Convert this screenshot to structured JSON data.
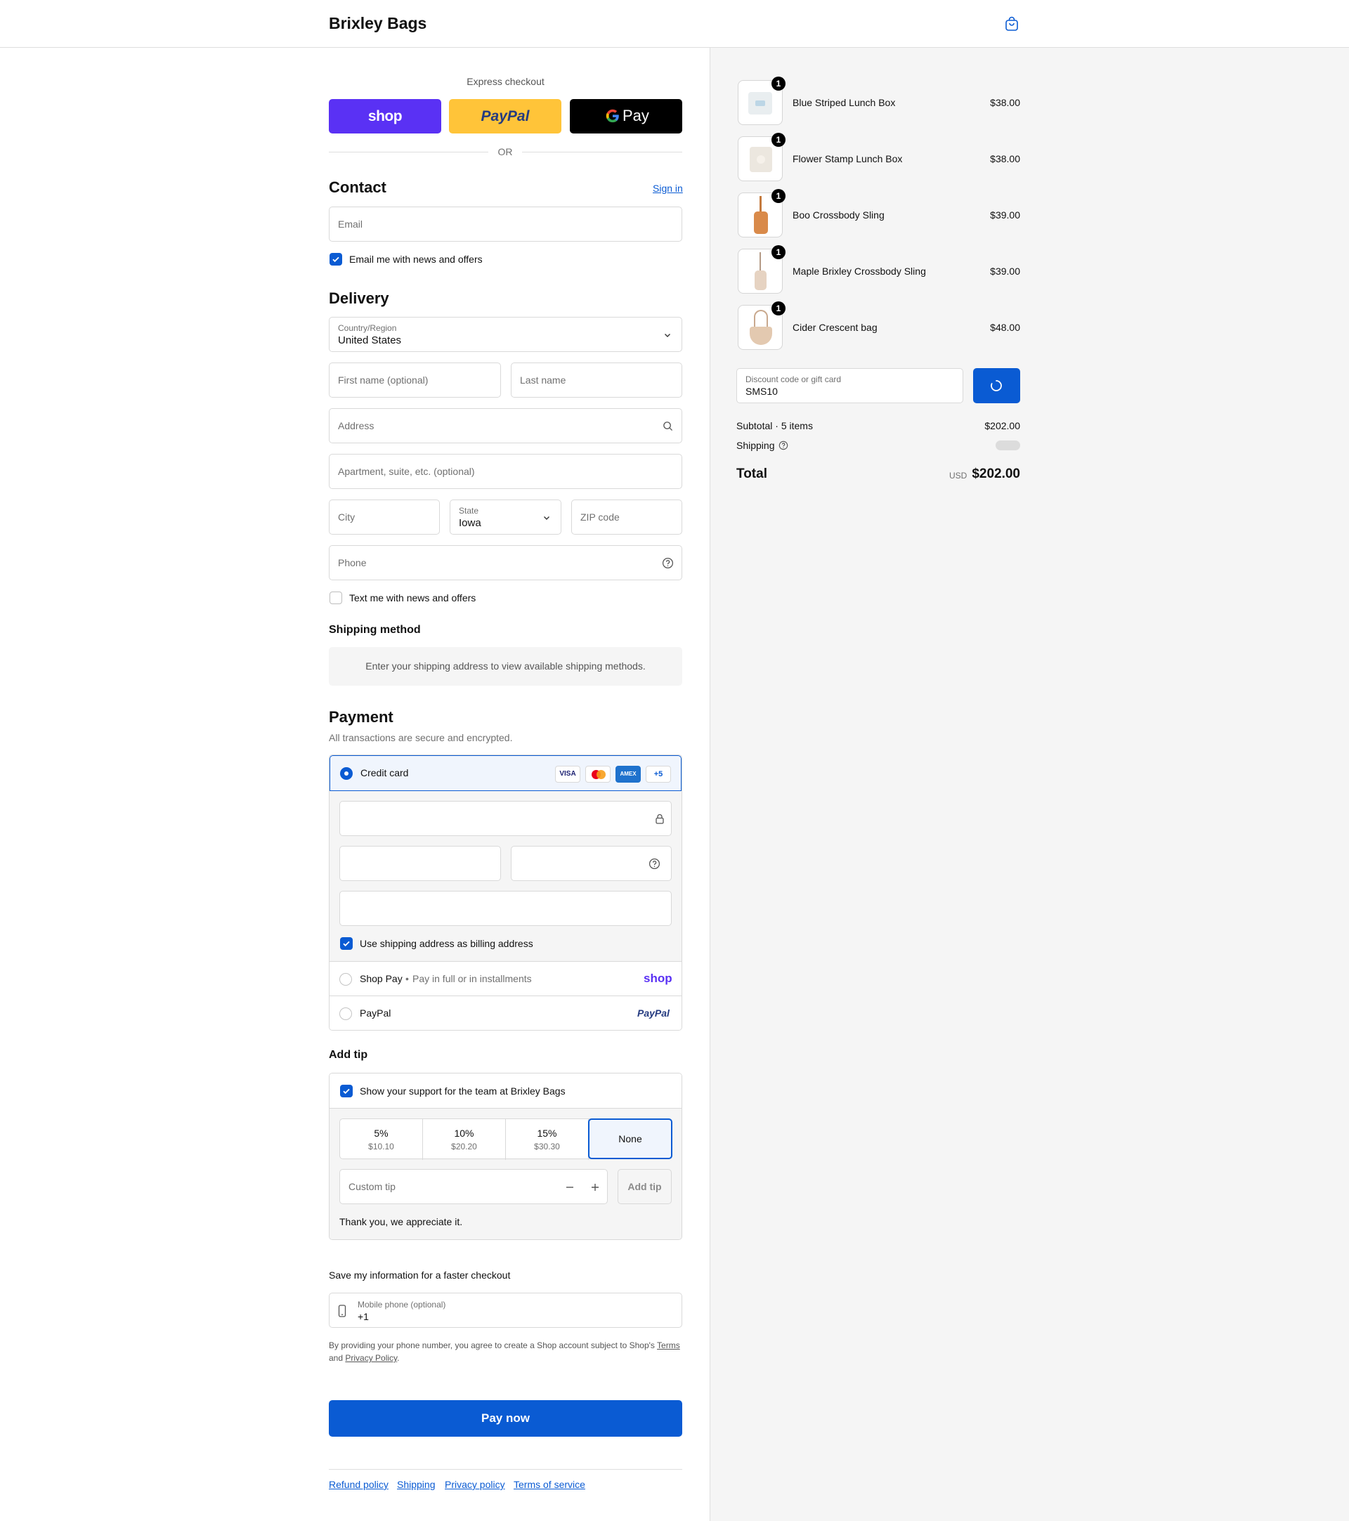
{
  "header": {
    "brand": "Brixley Bags",
    "cart_icon": "shopping-bag-icon"
  },
  "express": {
    "label": "Express checkout",
    "shop_label": "shop",
    "paypal_label": "PayPal",
    "gpay_label": "Pay",
    "or_label": "OR",
    "colors": {
      "shop": "#5a31f4",
      "paypal": "#ffc439",
      "gpay": "#000000"
    }
  },
  "contact": {
    "heading": "Contact",
    "sign_in": "Sign in",
    "email_placeholder": "Email",
    "news_checkbox": "Email me with news and offers",
    "news_checked": true
  },
  "delivery": {
    "heading": "Delivery",
    "country_label": "Country/Region",
    "country_value": "United States",
    "first_name_placeholder": "First name (optional)",
    "last_name_placeholder": "Last name",
    "address_placeholder": "Address",
    "apartment_placeholder": "Apartment, suite, etc. (optional)",
    "city_placeholder": "City",
    "state_label": "State",
    "state_value": "Iowa",
    "zip_placeholder": "ZIP code",
    "phone_placeholder": "Phone",
    "text_checkbox": "Text me with news and offers",
    "text_checked": false
  },
  "shipping_method": {
    "heading": "Shipping method",
    "notice": "Enter your shipping address to view available shipping methods."
  },
  "payment": {
    "heading": "Payment",
    "subtitle": "All transactions are secure and encrypted.",
    "credit_card_label": "Credit card",
    "card_brands": [
      "VISA",
      "mastercard",
      "AMEX",
      "+5"
    ],
    "billing_checkbox": "Use shipping address as billing address",
    "billing_checked": true,
    "shop_pay_label": "Shop Pay",
    "shop_pay_sub": "Pay in full or in installments",
    "shop_pay_logo": "shop",
    "paypal_label": "PayPal",
    "paypal_logo": "PayPal"
  },
  "tip": {
    "heading": "Add tip",
    "support_label": "Show your support for the team at Brixley Bags",
    "support_checked": true,
    "options": [
      {
        "percent": "5%",
        "amount": "$10.10"
      },
      {
        "percent": "10%",
        "amount": "$20.20"
      },
      {
        "percent": "15%",
        "amount": "$30.30"
      }
    ],
    "none_label": "None",
    "custom_placeholder": "Custom tip",
    "add_tip_label": "Add tip",
    "thanks": "Thank you, we appreciate it."
  },
  "save_info": {
    "heading": "Save my information for a faster checkout",
    "mobile_label": "Mobile phone (optional)",
    "mobile_value": "+1",
    "legal_prefix": "By providing your phone number, you agree to create a Shop account subject to Shop's",
    "terms": "Terms",
    "and": "and",
    "privacy": "Privacy Policy",
    "period": "."
  },
  "pay_now": "Pay now",
  "footer_links": [
    "Refund policy",
    "Shipping",
    "Privacy policy",
    "Terms of service"
  ],
  "cart": {
    "items": [
      {
        "name": "Blue Striped Lunch Box",
        "price": "$38.00",
        "qty": "1"
      },
      {
        "name": "Flower Stamp Lunch Box",
        "price": "$38.00",
        "qty": "1"
      },
      {
        "name": "Boo Crossbody Sling",
        "price": "$39.00",
        "qty": "1"
      },
      {
        "name": "Maple Brixley Crossbody Sling",
        "price": "$39.00",
        "qty": "1"
      },
      {
        "name": "Cider Crescent bag",
        "price": "$48.00",
        "qty": "1"
      }
    ],
    "discount_label": "Discount code or gift card",
    "discount_value": "SMS10",
    "subtotal_label": "Subtotal · 5 items",
    "subtotal_value": "$202.00",
    "shipping_label": "Shipping",
    "total_label": "Total",
    "currency": "USD",
    "total_value": "$202.00"
  },
  "accent_color": "#0a5bd3"
}
